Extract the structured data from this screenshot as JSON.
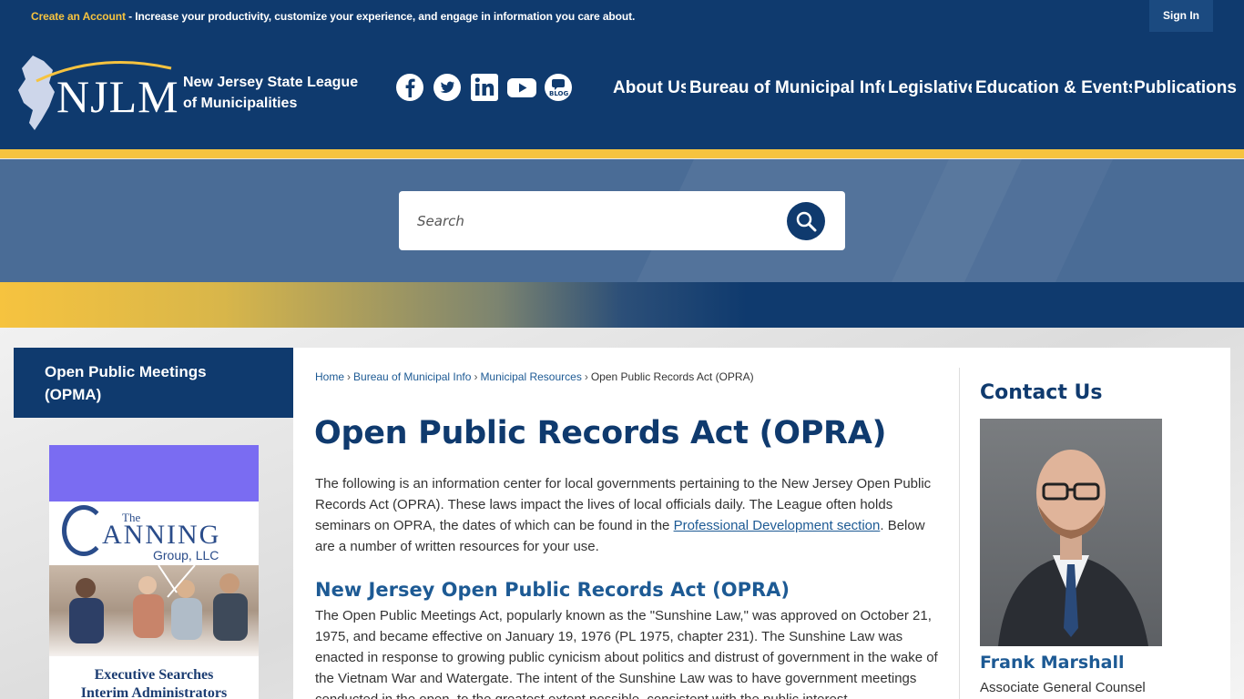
{
  "topbar": {
    "create_account": "Create an Account",
    "message": " - Increase your productivity, customize your experience, and engage in information you care about.",
    "sign_in": "Sign In"
  },
  "header": {
    "logo_text": "NJLM",
    "org_line1": "New Jersey State League",
    "org_line2": "of Municipalities",
    "social": [
      "facebook-icon",
      "twitter-icon",
      "linkedin-icon",
      "youtube-icon",
      "blog-icon"
    ],
    "blog_label": "BLOG",
    "nav": [
      "About Us",
      "Bureau of Municipal Info",
      "Legislative",
      "Education & Events",
      "Publications"
    ]
  },
  "search": {
    "placeholder": "Search"
  },
  "sidebar": {
    "nav_item": "Open Public Meetings (OPMA)",
    "ad": {
      "the": "The",
      "name": "ANNING",
      "group": "Group, LLC",
      "line1": "Executive Searches",
      "line2": "Interim Administrators"
    }
  },
  "breadcrumb": [
    "Home",
    "Bureau of Municipal Info",
    "Municipal Resources",
    "Open Public Records Act (OPRA)"
  ],
  "main": {
    "title": "Open Public Records Act (OPRA)",
    "intro_before": "The following is an information center for local governments pertaining to the New Jersey Open Public Records Act (OPRA). These laws impact the lives of local officials daily. The League often holds seminars on OPRA, the dates of which can be found in the ",
    "intro_link": "Professional Development section",
    "intro_after": ". Below are a number of written resources for your use.",
    "subheading": "New Jersey Open Public Records Act (OPRA)",
    "body": "The Open Public Meetings Act, popularly known as the \"Sunshine Law,\" was approved on October 21, 1975, and became effective on January 19, 1976 (PL 1975, chapter 231). The Sunshine Law was enacted in response to growing public cynicism about politics and distrust of government in the wake of the Vietnam War and Watergate. The intent of the Sunshine Law was to have government meetings conducted in the open, to the greatest extent possible, consistent with the public interest."
  },
  "contact": {
    "title": "Contact Us",
    "name": "Frank Marshall",
    "role": "Associate General Counsel"
  },
  "colors": {
    "navy": "#0f3a6e",
    "gold": "#f6c33f",
    "link": "#1d5a94"
  }
}
